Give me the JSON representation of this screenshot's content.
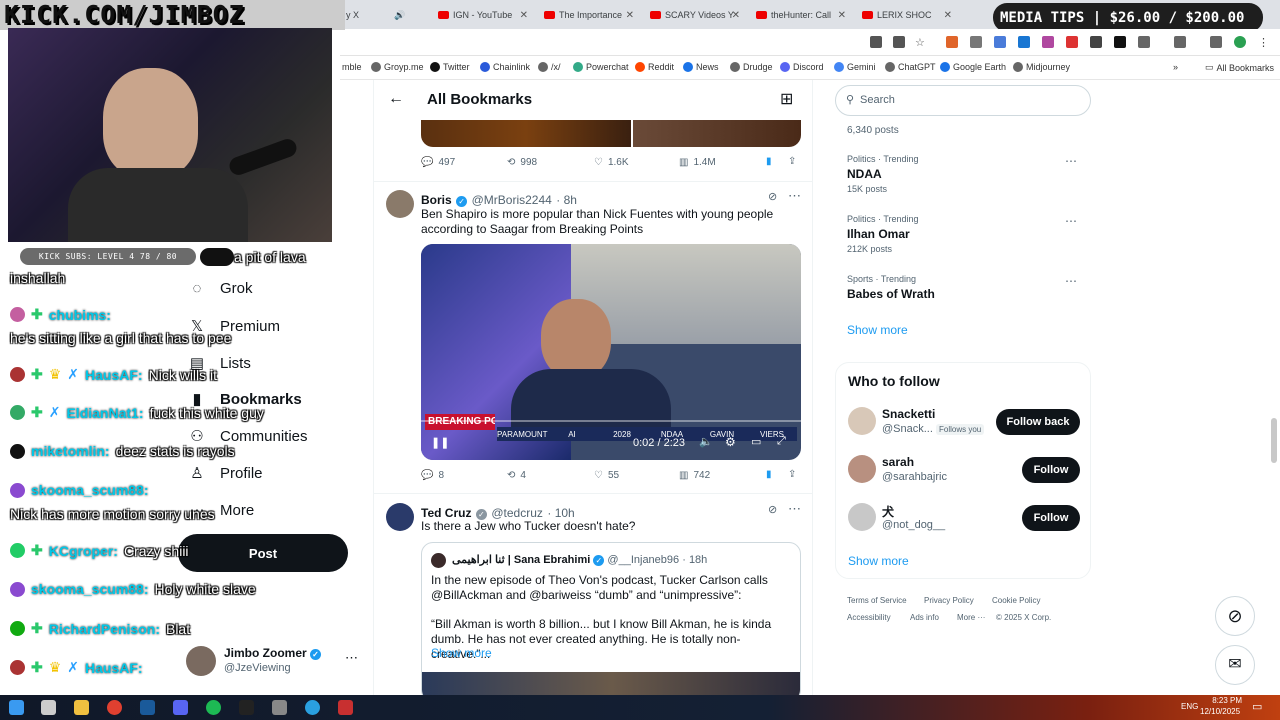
{
  "stream": {
    "brand": "KICK.COM/JIMBOZ",
    "subs": "KICK SUBS: LEVEL 4 78 / 80",
    "media_tips": "MEDIA TIPS | $26.00 / $200.00",
    "chat": [
      {
        "user": "",
        "msg": "a pit of lava"
      },
      {
        "user": "",
        "msg": "inshallah"
      },
      {
        "user": "chubims:",
        "msg": ""
      },
      {
        "user": "",
        "msg": "he's sitting like a girl that has to pee"
      },
      {
        "user": "HausAF:",
        "msg": "Nick wills it"
      },
      {
        "user": "EldianNat1:",
        "msg": "fuck this white guy"
      },
      {
        "user": "miketomlin:",
        "msg": "deez stats is rayols"
      },
      {
        "user": "skooma_scum88:",
        "msg": ""
      },
      {
        "user": "",
        "msg": "Nick has more motion sorry unes"
      },
      {
        "user": "KCgroper:",
        "msg": "Crazy shiii"
      },
      {
        "user": "skooma_scum88:",
        "msg": "Holy white slave"
      },
      {
        "user": "RichardPenison:",
        "msg": "Blat"
      },
      {
        "user": "HausAF:",
        "msg": ""
      }
    ]
  },
  "browser": {
    "tabs": [
      {
        "label": "y X"
      },
      {
        "label": "IGN - YouTube"
      },
      {
        "label": "The Importance"
      },
      {
        "label": "SCARY Videos Y"
      },
      {
        "label": "theHunter: Call"
      },
      {
        "label": "LERIX SHOC"
      }
    ],
    "bookmarks": [
      "mble",
      "Groyp.me",
      "Twitter",
      "Chainlink",
      "/x/",
      "Powerchat",
      "Reddit",
      "News",
      "Drudge",
      "Discord",
      "Gemini",
      "ChatGPT",
      "Google Earth",
      "Midjourney"
    ],
    "all_bookmarks": "All Bookmarks"
  },
  "nav": {
    "items": [
      "Grok",
      "Premium",
      "Lists",
      "Bookmarks",
      "Communities",
      "Profile",
      "More"
    ],
    "post": "Post",
    "account": {
      "name": "Jimbo Zoomer",
      "handle": "@JzeViewing"
    }
  },
  "center": {
    "title": "All Bookmarks",
    "tweet0_stats": {
      "replies": "497",
      "reposts": "998",
      "likes": "1.6K",
      "views": "1.4M"
    },
    "tweet1": {
      "name": "Boris",
      "handle": "@MrBoris2244",
      "time": "· 8h",
      "text": "Ben Shapiro is more popular than Nick Fuentes with young people according to Saagar from Breaking Points",
      "video_time": "0:02 / 2:23",
      "video_banner": "BREAKING POINTS",
      "ticker": [
        "PARAMOUNT",
        "AI",
        "2028",
        "NDAA",
        "GAVIN",
        "VIERS"
      ],
      "replies": "8",
      "reposts": "4",
      "likes": "55",
      "views": "742"
    },
    "tweet2": {
      "name": "Ted Cruz",
      "handle": "@tedcruz",
      "time": "· 10h",
      "text": "Is there a Jew who Tucker doesn't hate?",
      "quote": {
        "name": "ثنا ابراهیمی | Sana Ebrahimi",
        "handle": "@__Injaneb96",
        "time": "· 18h",
        "text1": "In the new episode of Theo Von's podcast, Tucker Carlson calls @BillAckman and @bariweiss “dumb” and “unimpressive”:",
        "text2": "“Bill Akman is worth 8 billion... but I know Bill Akman, he is kinda dumb. He has not ever created anything. He is totally non-creative.”...",
        "show_more": "Show more"
      }
    }
  },
  "right": {
    "search_placeholder": "Search",
    "top_count": "6,340 posts",
    "trends": [
      {
        "meta": "Politics · Trending",
        "title": "NDAA",
        "posts": "15K posts"
      },
      {
        "meta": "Politics · Trending",
        "title": "Ilhan Omar",
        "posts": "212K posts"
      },
      {
        "meta": "Sports · Trending",
        "title": "Babes of Wrath",
        "posts": ""
      }
    ],
    "show_more": "Show more",
    "who_title": "Who to follow",
    "follows": [
      {
        "name": "Snacketti",
        "handle": "@Snack...",
        "badge": "Follows you",
        "btn": "Follow back"
      },
      {
        "name": "sarah",
        "handle": "@sarahbajric",
        "badge": "",
        "btn": "Follow"
      },
      {
        "name": "犬",
        "handle": "@not_dog__",
        "badge": "",
        "btn": "Follow"
      }
    ],
    "show_more2": "Show more",
    "footer": [
      "Terms of Service",
      "Privacy Policy",
      "Cookie Policy",
      "Accessibility",
      "Ads info",
      "More ···",
      "© 2025 X Corp."
    ]
  },
  "taskbar": {
    "lang": "ENG",
    "time": "8:23 PM",
    "date": "12/10/2025"
  }
}
